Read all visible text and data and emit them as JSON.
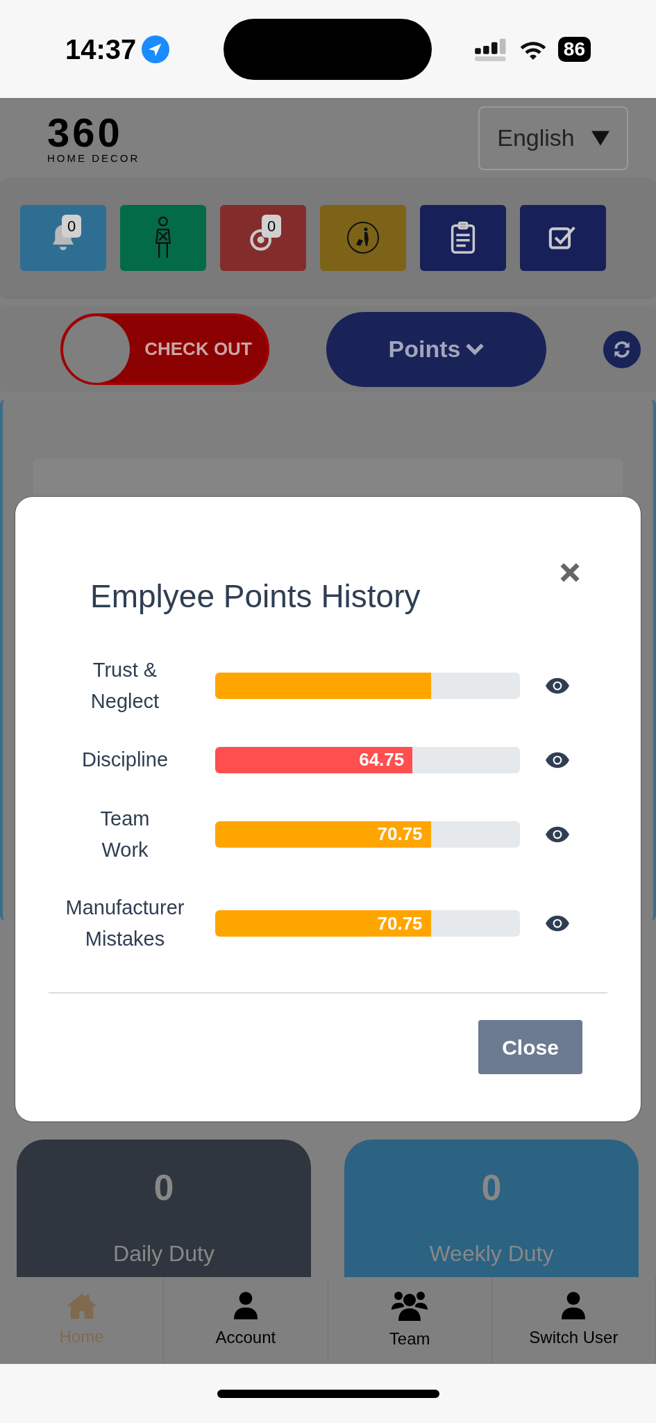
{
  "status_bar": {
    "time": "14:37",
    "battery": "86"
  },
  "header": {
    "logo": {
      "line_1": "360",
      "line_2": "HOME DECOR"
    },
    "language": "English"
  },
  "quick_actions": [
    {
      "kind": "bell",
      "color": "#2e6e93",
      "badge": "0"
    },
    {
      "kind": "person",
      "color": "#036b47"
    },
    {
      "kind": "coins",
      "color": "#842c2c",
      "badge": "0"
    },
    {
      "kind": "traveler",
      "color": "#7d6318"
    },
    {
      "kind": "clipboard",
      "color": "#18205a"
    },
    {
      "kind": "checkbox",
      "color": "#18205a"
    }
  ],
  "attendance_toggle": {
    "label": "CHECK OUT",
    "on": false
  },
  "points_button": "Points",
  "modal": {
    "title": "Emplyee Points History",
    "rows": [
      {
        "label": "Trust &\nNeglect",
        "level": 0.7075,
        "color": "#ffa500"
      },
      {
        "label": "Discipline",
        "level": 0.6475,
        "value": "64.75",
        "color": "#ff4f4f"
      },
      {
        "label": "Team\nWork",
        "level": 0.7075,
        "value": "70.75",
        "color": "#ffa500"
      },
      {
        "label": "Manufacturer\nMistakes",
        "level": 0.7075,
        "value": "70.75",
        "color": "#ffa500"
      }
    ],
    "close_button": "Close"
  },
  "duty_cards": [
    {
      "count": "0",
      "label": "Daily Duty",
      "color": "#30363f"
    },
    {
      "count": "0",
      "label": "Weekly Duty",
      "color": "#2c6282"
    }
  ],
  "bottom_nav": [
    {
      "label": "Home",
      "kind": "home",
      "selected": true
    },
    {
      "label": "Account",
      "kind": "user",
      "selected": false
    },
    {
      "label": "Team",
      "kind": "users",
      "selected": false
    },
    {
      "label": "Switch User",
      "kind": "user",
      "selected": false
    }
  ]
}
